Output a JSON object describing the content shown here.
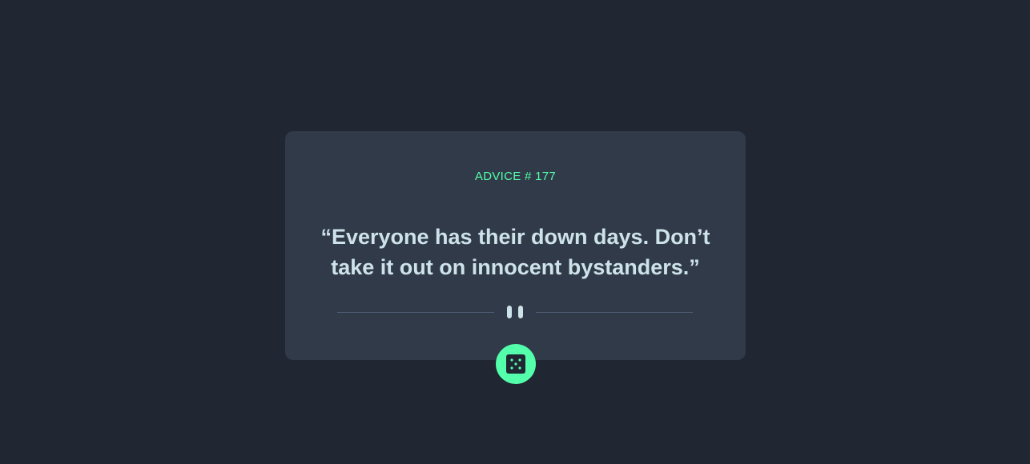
{
  "advice": {
    "id_label": "ADVICE # 177",
    "quote": "“Everyone has their down days. Don’t take it out on innocent bystanders.”"
  },
  "divider": {
    "icon": "pause-icon"
  },
  "dice_button": {
    "icon": "dice-icon"
  },
  "colors": {
    "background": "#202632",
    "card": "#313a49",
    "accent": "#53ffaa",
    "quote_text": "#cee3e9",
    "divider_line": "#4f5d74"
  }
}
